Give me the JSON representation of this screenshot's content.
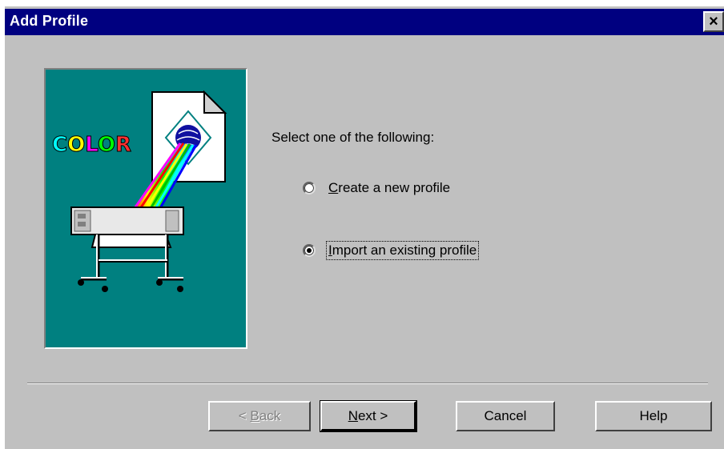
{
  "window": {
    "title": "Add Profile",
    "close_symbol": "×"
  },
  "illustration": {
    "icon": "color-printer-illustration",
    "color_text": "COLOR"
  },
  "main": {
    "prompt": "Select one of the following:",
    "options": [
      {
        "mnemonic": "C",
        "rest": "reate a new profile",
        "checked": false
      },
      {
        "mnemonic": "I",
        "rest": "mport an existing profile",
        "checked": true
      }
    ]
  },
  "buttons": {
    "back": {
      "prefix": "< ",
      "mnemonic": "B",
      "rest": "ack",
      "enabled": false
    },
    "next": {
      "mnemonic": "N",
      "rest": "ext >",
      "enabled": true,
      "default": true
    },
    "cancel": {
      "label": "Cancel"
    },
    "help": {
      "label": "Help"
    }
  },
  "colors": {
    "titlebar": "#000080",
    "dialog_bg": "#c0c0c0",
    "illustration_bg": "#008080"
  }
}
